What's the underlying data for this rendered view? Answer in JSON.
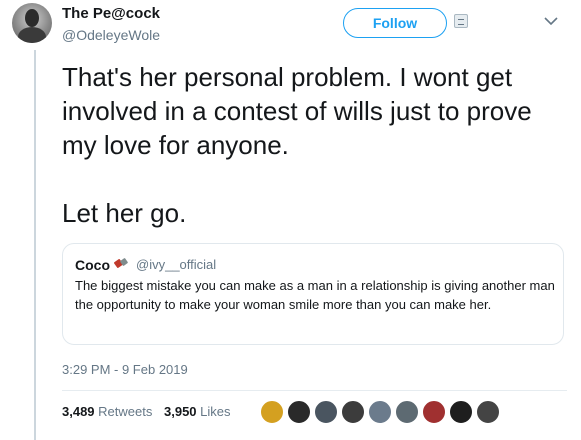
{
  "author": {
    "display_name": "The Pe@cock",
    "handle": "@OdeleyeWole"
  },
  "follow": {
    "label": "Follow",
    "icon": "dm-icon"
  },
  "menu": {
    "icon": "chevron-down-icon"
  },
  "tweet": {
    "text": "That's her personal problem. I wont get involved in a contest of wills just to prove my love for anyone.\n\nLet her go.",
    "timestamp": "3:29 PM - 9 Feb 2019"
  },
  "quoted": {
    "name": "Coco",
    "emoji": "lipstick-emoji",
    "handle": "@ivy__official",
    "text": "The biggest mistake you can make as a man in a relationship is giving another man the opportunity to make your woman smile more than you can make her."
  },
  "stats": {
    "retweets_count": "3,489",
    "retweets_label": "Retweets",
    "likes_count": "3,950",
    "likes_label": "Likes"
  },
  "likers": [
    {
      "color": "#d4a020"
    },
    {
      "color": "#2a2a2a"
    },
    {
      "color": "#4a5560"
    },
    {
      "color": "#3c3c3c"
    },
    {
      "color": "#6b7b8c"
    },
    {
      "color": "#5d6a72"
    },
    {
      "color": "#a03030"
    },
    {
      "color": "#1e1e1e"
    },
    {
      "color": "#444444"
    }
  ]
}
